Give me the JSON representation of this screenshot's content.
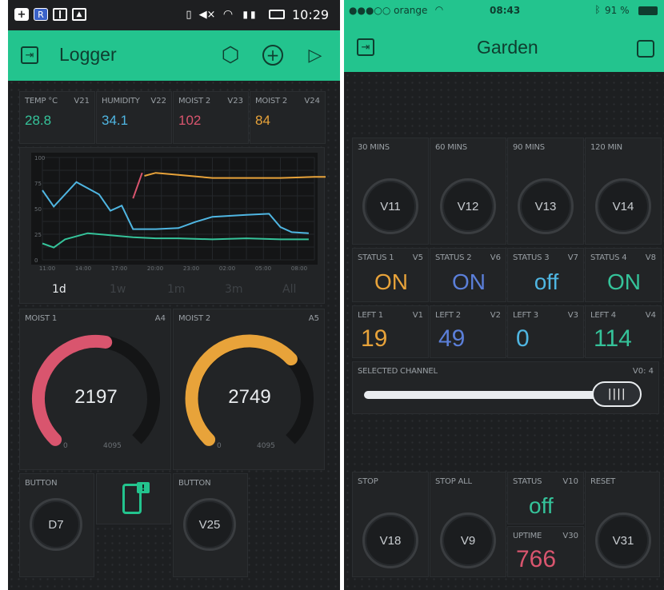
{
  "left": {
    "status": {
      "time": "10:29",
      "icons": [
        "plus-badge-icon",
        "r-app-icon",
        "reader-icon",
        "gallery-icon",
        "vibrate-icon",
        "mute-icon",
        "wifi-icon",
        "signal-icon",
        "battery-icon"
      ]
    },
    "appbar": {
      "title": "Logger",
      "icons": [
        "back-icon",
        "settings-icon",
        "add-icon",
        "play-icon"
      ]
    },
    "values": [
      {
        "label": "TEMP °C",
        "pin": "V21",
        "value": "28.8",
        "color": "#35c39a"
      },
      {
        "label": "HUMIDITY",
        "pin": "V22",
        "value": "34.1",
        "color": "#4fb6e2"
      },
      {
        "label": "MOIST 2",
        "pin": "V23",
        "value": "102",
        "color": "#d9556e"
      },
      {
        "label": "MOIST 2",
        "pin": "V24",
        "value": "84",
        "color": "#e8a33a"
      }
    ],
    "chart_data": {
      "type": "line",
      "y_ticks": [
        "100",
        "75",
        "50",
        "25",
        "0"
      ],
      "x_ticks": [
        "11:00",
        "14:00",
        "17:00",
        "20:00",
        "23:00",
        "02:00",
        "05:00",
        "08:00"
      ],
      "ylim": [
        0,
        100
      ],
      "series": [
        {
          "color": "#e8a33a",
          "points": [
            [
              20.0,
              82
            ],
            [
              21.0,
              85
            ],
            [
              23,
              83
            ],
            [
              26,
              80
            ],
            [
              29,
              80
            ],
            [
              32,
              80
            ],
            [
              35,
              81
            ],
            [
              37,
              81
            ]
          ]
        },
        {
          "color": "#d9556e",
          "points": [
            [
              19.0,
              60
            ],
            [
              19.8,
              85
            ]
          ]
        },
        {
          "color": "#4fb6e2",
          "points": [
            [
              11,
              68
            ],
            [
              12,
              52
            ],
            [
              14,
              76
            ],
            [
              16,
              64
            ],
            [
              17,
              48
            ],
            [
              18,
              53
            ],
            [
              19,
              30
            ],
            [
              21,
              30
            ],
            [
              23,
              31
            ],
            [
              24.5,
              37
            ],
            [
              26,
              42
            ],
            [
              29,
              44
            ],
            [
              31,
              45
            ],
            [
              32,
              32
            ],
            [
              33,
              27
            ],
            [
              34.5,
              26
            ]
          ]
        },
        {
          "color": "#35c39a",
          "points": [
            [
              11,
              16
            ],
            [
              12,
              12
            ],
            [
              13,
              20
            ],
            [
              15,
              26
            ],
            [
              17,
              24
            ],
            [
              19,
              22
            ],
            [
              21,
              21
            ],
            [
              23,
              21
            ],
            [
              26,
              20
            ],
            [
              29,
              21
            ],
            [
              32,
              20
            ],
            [
              34.5,
              20
            ]
          ]
        }
      ]
    },
    "tabs": [
      "1d",
      "1w",
      "1m",
      "3m",
      "All"
    ],
    "gauges": [
      {
        "label": "MOIST 1",
        "pin": "A4",
        "value": "2197",
        "min": "0",
        "max": "4095",
        "fraction": 0.536,
        "color": "#d9556e"
      },
      {
        "label": "MOIST 2",
        "pin": "A5",
        "value": "2749",
        "min": "0",
        "max": "4095",
        "fraction": 0.671,
        "color": "#e8a33a"
      }
    ],
    "buttons": [
      {
        "label": "BUTTON",
        "pin": "D7"
      },
      {
        "label": "BUTTON",
        "pin": "V25"
      }
    ]
  },
  "right": {
    "status": {
      "carrier": "●●●○○ orange",
      "time": "08:43",
      "battery": "91 %"
    },
    "appbar": {
      "title": "Garden"
    },
    "timers": [
      {
        "label": "30 MINS",
        "pin": "V11"
      },
      {
        "label": "60 MINS",
        "pin": "V12"
      },
      {
        "label": "90 MINS",
        "pin": "V13"
      },
      {
        "label": "120 MIN",
        "pin": "V14"
      }
    ],
    "statuses": [
      {
        "label": "STATUS 1",
        "pin": "V5",
        "value": "ON",
        "color": "#e8a33a"
      },
      {
        "label": "STATUS 2",
        "pin": "V6",
        "value": "ON",
        "color": "#5b7fd9"
      },
      {
        "label": "STATUS 3",
        "pin": "V7",
        "value": "off",
        "color": "#4fb6e2"
      },
      {
        "label": "STATUS 4",
        "pin": "V8",
        "value": "ON",
        "color": "#35c39a"
      }
    ],
    "lefts": [
      {
        "label": "LEFT 1",
        "pin": "V1",
        "value": "19",
        "color": "#e8a33a"
      },
      {
        "label": "LEFT 2",
        "pin": "V2",
        "value": "49",
        "color": "#5b7fd9"
      },
      {
        "label": "LEFT 3",
        "pin": "V3",
        "value": "0",
        "color": "#4fb6e2"
      },
      {
        "label": "LEFT 4",
        "pin": "V4",
        "value": "114",
        "color": "#35c39a"
      }
    ],
    "slider": {
      "label": "SELECTED CHANNEL",
      "pin": "V0: 4",
      "fraction": 0.93
    },
    "bottom": {
      "stop": {
        "label": "STOP",
        "pin": "V18"
      },
      "stop_all": {
        "label": "STOP ALL",
        "pin": "V9"
      },
      "status": {
        "label": "STATUS",
        "pin": "V10",
        "value": "off",
        "color": "#35c39a"
      },
      "uptime": {
        "label": "UPTIME",
        "pin": "V30",
        "value": "766",
        "color": "#d9556e"
      },
      "reset": {
        "label": "RESET",
        "pin": "V31"
      }
    }
  }
}
